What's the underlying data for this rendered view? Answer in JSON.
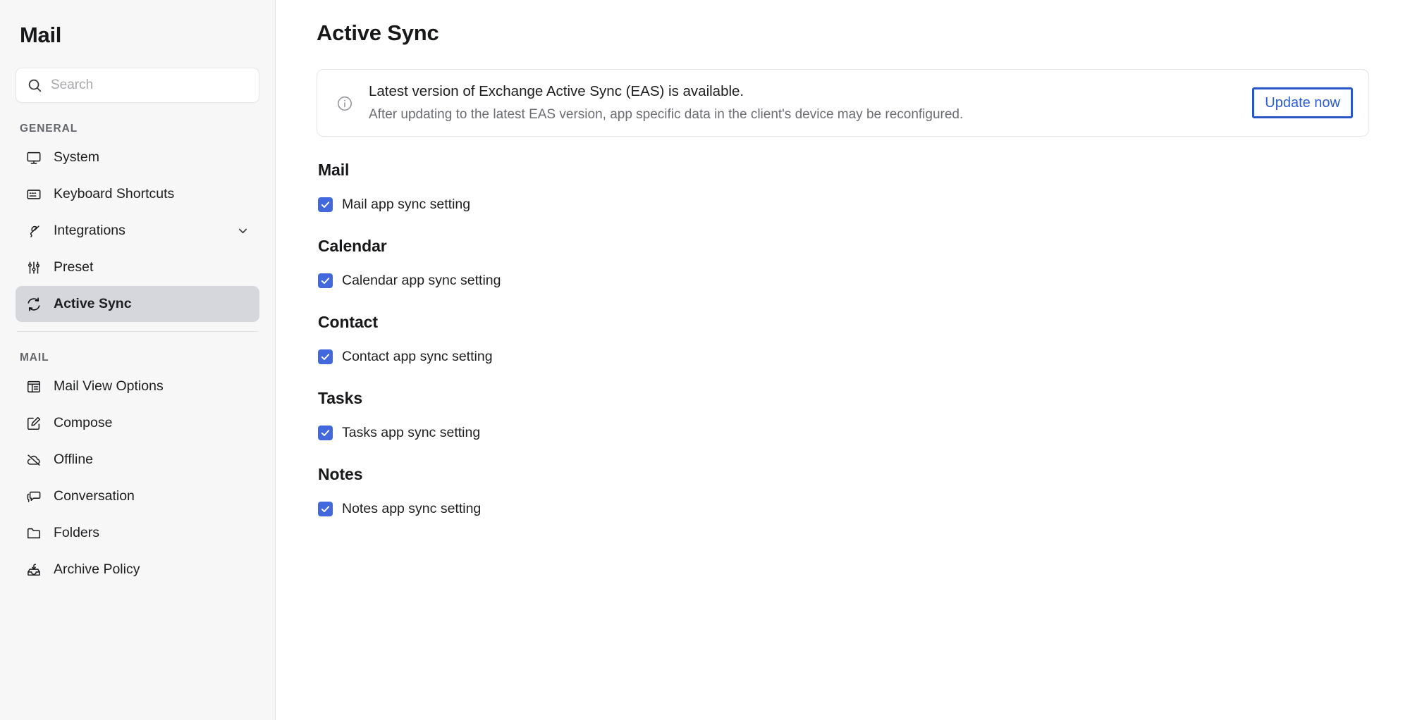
{
  "sidebar": {
    "title": "Mail",
    "search": {
      "placeholder": "Search",
      "value": "",
      "icon": "search-icon"
    },
    "sections": [
      {
        "label": "GENERAL",
        "items": [
          {
            "label": "System",
            "icon": "monitor-icon",
            "selected": false,
            "chevron": false
          },
          {
            "label": "Keyboard Shortcuts",
            "icon": "keyboard-icon",
            "selected": false,
            "chevron": false
          },
          {
            "label": "Integrations",
            "icon": "plug-icon",
            "selected": false,
            "chevron": true
          },
          {
            "label": "Preset",
            "icon": "sliders-icon",
            "selected": false,
            "chevron": false
          },
          {
            "label": "Active Sync",
            "icon": "refresh-sync-icon",
            "selected": true,
            "chevron": false
          }
        ]
      },
      {
        "label": "MAIL",
        "items": [
          {
            "label": "Mail View Options",
            "icon": "layout-panel-icon",
            "selected": false,
            "chevron": false
          },
          {
            "label": "Compose",
            "icon": "pencil-square-icon",
            "selected": false,
            "chevron": false
          },
          {
            "label": "Offline",
            "icon": "cloud-slash-icon",
            "selected": false,
            "chevron": false
          },
          {
            "label": "Conversation",
            "icon": "chat-bubbles-icon",
            "selected": false,
            "chevron": false
          },
          {
            "label": "Folders",
            "icon": "folder-icon",
            "selected": false,
            "chevron": false
          },
          {
            "label": "Archive Policy",
            "icon": "archive-inbox-icon",
            "selected": false,
            "chevron": false
          }
        ]
      }
    ]
  },
  "main": {
    "page_title": "Active Sync",
    "banner": {
      "icon": "info-circle-icon",
      "title": "Latest version of Exchange Active Sync (EAS) is available.",
      "subtitle": "After updating to the latest EAS version, app specific data in the client's device may be reconfigured.",
      "action_label": "Update now"
    },
    "groups": [
      {
        "title": "Mail",
        "checkbox_label": "Mail app sync setting",
        "checked": true
      },
      {
        "title": "Calendar",
        "checkbox_label": "Calendar app sync setting",
        "checked": true
      },
      {
        "title": "Contact",
        "checkbox_label": "Contact app sync setting",
        "checked": true
      },
      {
        "title": "Tasks",
        "checkbox_label": "Tasks app sync setting",
        "checked": true
      },
      {
        "title": "Notes",
        "checkbox_label": "Notes app sync setting",
        "checked": true
      }
    ]
  },
  "colors": {
    "accent_blue": "#4169dd",
    "button_blue": "#2a5bd7",
    "focus_border": "#2a55c9",
    "sidebar_bg": "#f7f7f7",
    "selected_item_bg": "#d5d7dc"
  }
}
